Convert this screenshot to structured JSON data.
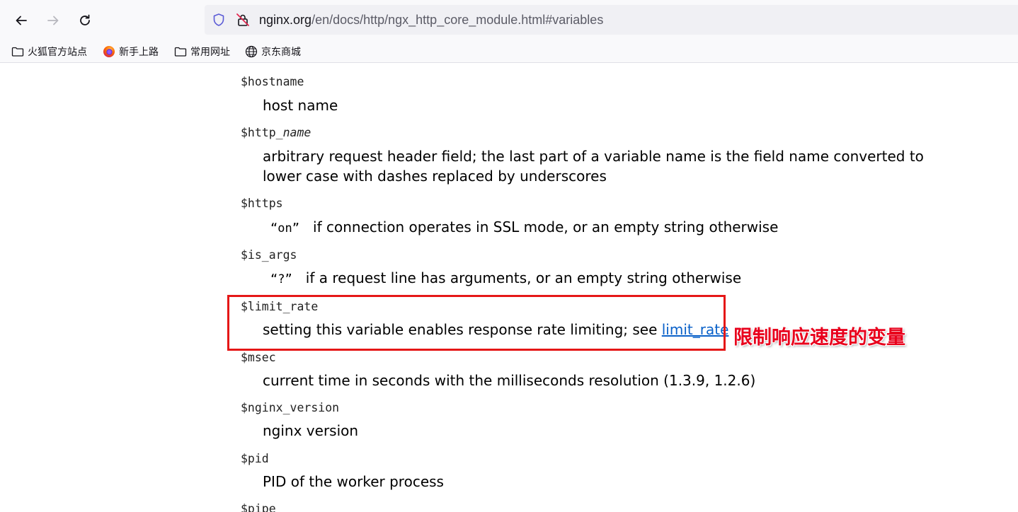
{
  "browser": {
    "url": {
      "host": "nginx.org",
      "path": "/en/docs/http/ngx_http_core_module.html#variables"
    },
    "bookmarks": [
      {
        "label": "火狐官方站点",
        "icon": "folder-icon"
      },
      {
        "label": "新手上路",
        "icon": "firefox-icon"
      },
      {
        "label": "常用网址",
        "icon": "folder-icon"
      },
      {
        "label": "京东商城",
        "icon": "globe-icon"
      }
    ]
  },
  "variables": [
    {
      "name": "$hostname",
      "desc": "host name"
    },
    {
      "name_prefix": "$http_",
      "name_italic": "name",
      "desc": "arbitrary request header field; the last part of a variable name is the field name converted to lower case with dashes replaced by underscores"
    },
    {
      "name": "$https",
      "quote": "“on”",
      "desc": "if connection operates in SSL mode, or an empty string otherwise"
    },
    {
      "name": "$is_args",
      "quote": "“?”",
      "desc": "if a request line has arguments, or an empty string otherwise"
    },
    {
      "name": "$limit_rate",
      "desc": "setting this variable enables response rate limiting; see ",
      "link": "limit_rate"
    },
    {
      "name": "$msec",
      "desc": "current time in seconds with the milliseconds resolution (1.3.9, 1.2.6)"
    },
    {
      "name": "$nginx_version",
      "desc": "nginx version"
    },
    {
      "name": "$pid",
      "desc": "PID of the worker process"
    },
    {
      "name": "$pipe"
    }
  ],
  "annotation": {
    "text": "限制响应速度的变量",
    "color": "#e8001c",
    "box_color": "#e51717"
  }
}
